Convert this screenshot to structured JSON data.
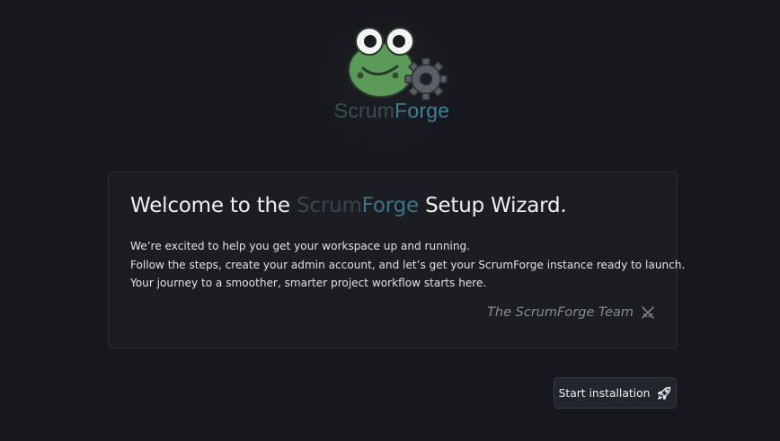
{
  "logo": {
    "text_part1": "Scrum",
    "text_part2": "Forge",
    "icon": "frog-gear-icon",
    "colors": {
      "frog": "#5c9a5a",
      "gear": "#5a5f66",
      "text_dark": "#3b4e52",
      "text_accent": "#3e7f93"
    }
  },
  "welcome": {
    "title_prefix": "Welcome to the ",
    "title_brand_1": "Scrum",
    "title_brand_2": "Forge",
    "title_suffix": " Setup Wizard.",
    "lines": [
      "We’re excited to help you get your workspace up and running.",
      "Follow the steps, create your admin account, and let’s get your ScrumForge instance ready to launch.",
      "Your journey to a smoother, smarter project workflow starts here."
    ],
    "signature": "The ScrumForge Team",
    "signature_icon": "crossed-swords-icon"
  },
  "actions": {
    "start_label": "Start installation",
    "start_icon": "rocket-icon"
  },
  "colors": {
    "background": "#16181d",
    "card": "#1b1d22",
    "accent": "#3e7f93"
  }
}
